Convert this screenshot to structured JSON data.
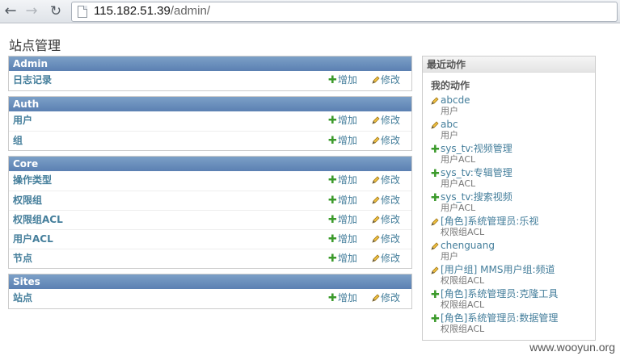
{
  "browser": {
    "url_host": "115.182.51.39",
    "url_path": "/admin/"
  },
  "page": {
    "title": "站点管理"
  },
  "modules": [
    {
      "caption": "Admin",
      "rows": [
        {
          "name": "日志记录",
          "add": "增加",
          "change": "修改"
        }
      ]
    },
    {
      "caption": "Auth",
      "rows": [
        {
          "name": "用户",
          "add": "增加",
          "change": "修改"
        },
        {
          "name": "组",
          "add": "增加",
          "change": "修改"
        }
      ]
    },
    {
      "caption": "Core",
      "rows": [
        {
          "name": "操作类型",
          "add": "增加",
          "change": "修改"
        },
        {
          "name": "权限组",
          "add": "增加",
          "change": "修改"
        },
        {
          "name": "权限组ACL",
          "add": "增加",
          "change": "修改"
        },
        {
          "name": "用户ACL",
          "add": "增加",
          "change": "修改"
        },
        {
          "name": "节点",
          "add": "增加",
          "change": "修改"
        }
      ]
    },
    {
      "caption": "Sites",
      "rows": [
        {
          "name": "站点",
          "add": "增加",
          "change": "修改"
        }
      ]
    }
  ],
  "recent": {
    "caption": "最近动作",
    "heading": "我的动作",
    "items": [
      {
        "icon": "pencil-icon",
        "title": "abcde",
        "type": "用户"
      },
      {
        "icon": "pencil-icon",
        "title": "abc",
        "type": "用户"
      },
      {
        "icon": "plus-icon",
        "title": "sys_tv:视频管理",
        "type": "用户ACL"
      },
      {
        "icon": "plus-icon",
        "title": "sys_tv:专辑管理",
        "type": "用户ACL"
      },
      {
        "icon": "plus-icon",
        "title": "sys_tv:搜索视频",
        "type": "用户ACL"
      },
      {
        "icon": "pencil-icon",
        "title": "[角色]系统管理员:乐视",
        "type": "权限组ACL"
      },
      {
        "icon": "pencil-icon",
        "title": "chenguang",
        "type": "用户"
      },
      {
        "icon": "pencil-icon",
        "title": "[用户组] MMS用户组:频道",
        "type": "权限组ACL"
      },
      {
        "icon": "plus-icon",
        "title": "[角色]系统管理员:克隆工具",
        "type": "权限组ACL"
      },
      {
        "icon": "plus-icon",
        "title": "[角色]系统管理员:数据管理",
        "type": "权限组ACL"
      }
    ]
  },
  "watermark": "www.wooyun.org",
  "colors": {
    "caption_blue": "#5b80b2",
    "link": "#447e9b",
    "add_green": "#3b9a2b"
  }
}
